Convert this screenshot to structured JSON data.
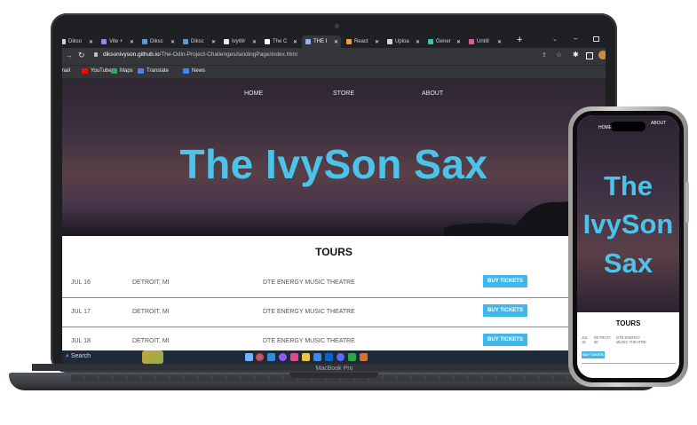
{
  "browser": {
    "tabs": [
      {
        "label": "Dikso",
        "color": "#cfd3d8"
      },
      {
        "label": "Vite +",
        "color": "#a07cf0"
      },
      {
        "label": "Diksc",
        "color": "#5b9bd5"
      },
      {
        "label": "Diksc",
        "color": "#5b9bd5"
      },
      {
        "label": "IvyWr",
        "color": "#e8e8e8"
      },
      {
        "label": "The C",
        "color": "#ffffff"
      },
      {
        "label": "THE I",
        "color": "#8ab4f8"
      },
      {
        "label": "React",
        "color": "#f0a030"
      },
      {
        "label": "Uploa",
        "color": "#cfd3d8"
      },
      {
        "label": "Gener",
        "color": "#36c5b0"
      },
      {
        "label": "Untitl",
        "color": "#e05a9c"
      }
    ],
    "url_domain": "diksonivyson.github.io",
    "url_path": "/The-Odin-Project-Challenges/landingPage/index.html",
    "bookmarks": [
      {
        "label": "mail",
        "color": "#1f2024"
      },
      {
        "label": "YouTube",
        "color": "#ff0000"
      },
      {
        "label": "Maps",
        "color": "#34a853"
      },
      {
        "label": "Translate",
        "color": "#4285f4"
      },
      {
        "label": "News",
        "color": "#4285f4"
      }
    ]
  },
  "site": {
    "nav": {
      "home": "HOME",
      "store": "STORE",
      "about": "ABOUT"
    },
    "title": "The IvySon Sax",
    "tours_heading": "TOURS",
    "buy_label": "BUY TICKETS",
    "tours": [
      {
        "date": "JUL 16",
        "city": "DETROIT, MI",
        "venue": "DTE ENERGY MUSIC THEATRE"
      },
      {
        "date": "JUL 17",
        "city": "DETROIT, MI",
        "venue": "DTE ENERGY MUSIC THEATRE"
      },
      {
        "date": "JUL 18",
        "city": "DETROIT, MI",
        "venue": "DTE ENERGY MUSIC THEATRE"
      }
    ]
  },
  "taskbar": {
    "search": "Search"
  },
  "laptop_label": "MacBook Pro",
  "phone": {
    "nav_home": "HOME",
    "nav_about": "ABOUT",
    "title_lines": [
      "The",
      "IvySon",
      "Sax"
    ],
    "tours_heading": "TOURS",
    "row": {
      "date_a": "JUL",
      "date_b": "16",
      "city_a": "DETROIT,",
      "city_b": "MI",
      "venue_a": "DTE ENERGY",
      "venue_b": "MUSIC THEATRE"
    },
    "buy_label": "BUY TICKETS"
  },
  "colors": {
    "accent": "#4cc3ea",
    "button": "#3fb7ea"
  }
}
